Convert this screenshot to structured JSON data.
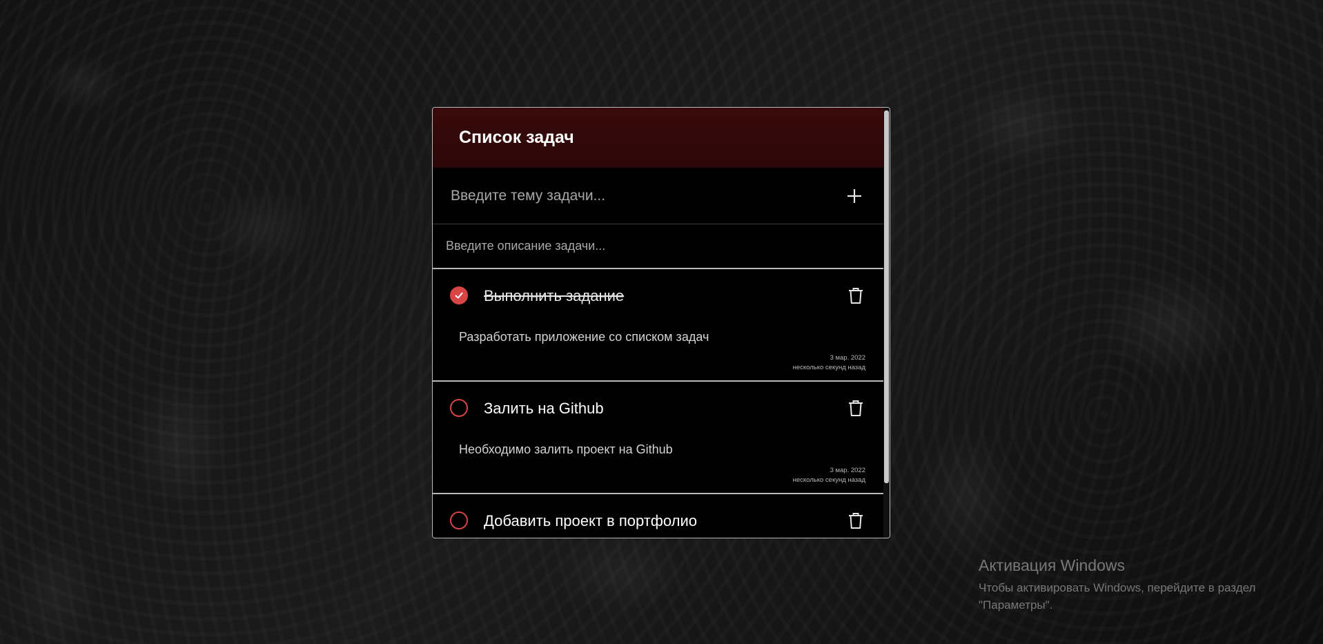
{
  "app": {
    "title": "Список задач"
  },
  "form": {
    "title_placeholder": "Введите тему задачи...",
    "description_placeholder": "Введите описание задачи...",
    "add_icon": "plus-icon"
  },
  "tasks": [
    {
      "title": "Выполнить задание",
      "description": "Разработать приложение со списком задач",
      "date": "3 мар. 2022",
      "relative_time": "несколько секунд назад",
      "completed": true
    },
    {
      "title": "Залить на Github",
      "description": "Необходимо залить проект на Github",
      "date": "3 мар. 2022",
      "relative_time": "несколько секунд назад",
      "completed": false
    },
    {
      "title": "Добавить проект в портфолио",
      "completed": false
    }
  ],
  "colors": {
    "accent": "#d84545",
    "header_bg": "#3a0a0a",
    "card_bg": "#000000",
    "text": "#ffffff"
  },
  "watermark": {
    "title": "Активация Windows",
    "text": "Чтобы активировать Windows, перейдите в раздел \"Параметры\"."
  }
}
